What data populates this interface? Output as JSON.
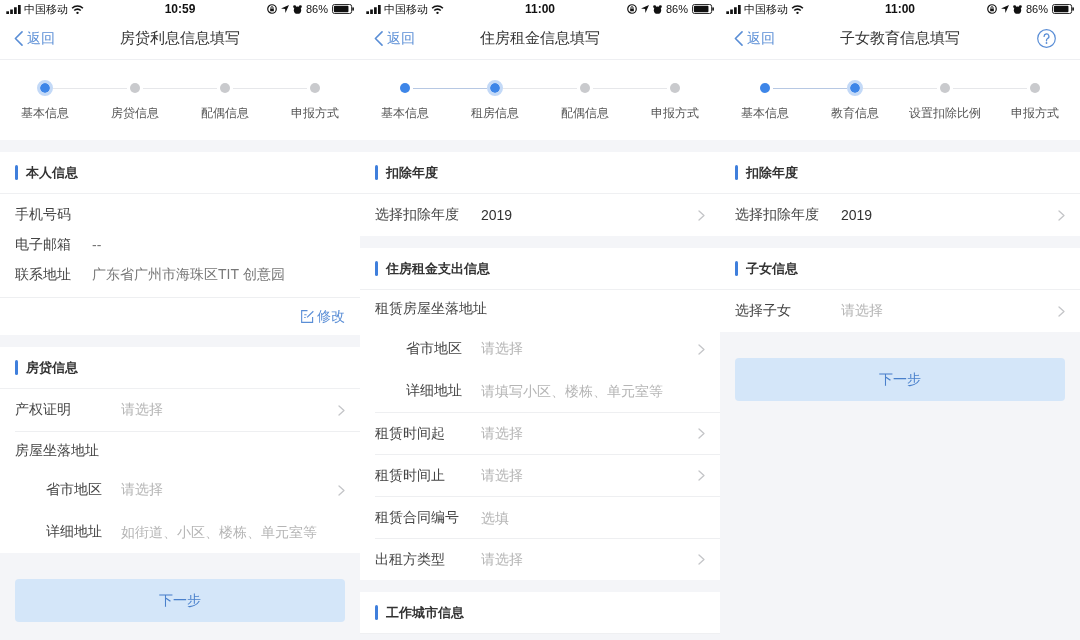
{
  "screens": [
    {
      "status_bar": {
        "carrier": "中国移动",
        "time": "10:59",
        "battery": "86%"
      },
      "nav": {
        "back": "返回",
        "title": "房贷利息信息填写"
      },
      "steps": [
        {
          "label": "基本信息",
          "done": false,
          "active": true
        },
        {
          "label": "房贷信息",
          "done": false,
          "active": false
        },
        {
          "label": "配偶信息",
          "done": false,
          "active": false
        },
        {
          "label": "申报方式",
          "done": false,
          "active": false
        }
      ],
      "sections": [
        {
          "title": "本人信息",
          "rows": [
            {
              "kind": "info",
              "label": "手机号码"
            },
            {
              "kind": "info",
              "label": "电子邮箱",
              "value": "--"
            },
            {
              "kind": "info",
              "label": "联系地址",
              "value": "广东省广州市海珠区TIT 创意园"
            }
          ],
          "action": "修改"
        },
        {
          "title": "房贷信息",
          "rows": [
            {
              "kind": "select",
              "label": "产权证明",
              "placeholder": "请选择"
            },
            {
              "kind": "group",
              "label": "房屋坐落地址",
              "children": [
                {
                  "kind": "select",
                  "label": "省市地区",
                  "placeholder": "请选择"
                },
                {
                  "kind": "input",
                  "label": "详细地址",
                  "placeholder": "如街道、小区、楼栋、单元室等"
                }
              ]
            }
          ]
        }
      ],
      "next_button": {
        "label": "下一步",
        "disabled": true
      }
    },
    {
      "status_bar": {
        "carrier": "中国移动",
        "time": "11:00",
        "battery": "86%"
      },
      "nav": {
        "back": "返回",
        "title": "住房租金信息填写"
      },
      "steps": [
        {
          "label": "基本信息",
          "done": true,
          "active": false
        },
        {
          "label": "租房信息",
          "done": false,
          "active": true
        },
        {
          "label": "配偶信息",
          "done": false,
          "active": false
        },
        {
          "label": "申报方式",
          "done": false,
          "active": false
        }
      ],
      "sections": [
        {
          "title": "扣除年度",
          "rows": [
            {
              "kind": "select",
              "label": "选择扣除年度",
              "value": "2019"
            }
          ]
        },
        {
          "title": "住房租金支出信息",
          "rows": [
            {
              "kind": "group",
              "label": "租赁房屋坐落地址",
              "children": [
                {
                  "kind": "select",
                  "label": "省市地区",
                  "placeholder": "请选择"
                },
                {
                  "kind": "input",
                  "label": "详细地址",
                  "placeholder": "请填写小区、楼栋、单元室等"
                }
              ]
            },
            {
              "kind": "select",
              "label": "租赁时间起",
              "placeholder": "请选择"
            },
            {
              "kind": "select",
              "label": "租赁时间止",
              "placeholder": "请选择"
            },
            {
              "kind": "input",
              "label": "租赁合同编号",
              "placeholder": "选填"
            },
            {
              "kind": "select",
              "label": "出租方类型",
              "placeholder": "请选择"
            }
          ]
        },
        {
          "title": "工作城市信息"
        }
      ]
    },
    {
      "status_bar": {
        "carrier": "中国移动",
        "time": "11:00",
        "battery": "86%"
      },
      "nav": {
        "back": "返回",
        "title": "子女教育信息填写",
        "help": true
      },
      "steps": [
        {
          "label": "基本信息",
          "done": true,
          "active": false
        },
        {
          "label": "教育信息",
          "done": false,
          "active": true
        },
        {
          "label": "设置扣除比例",
          "done": false,
          "active": false
        },
        {
          "label": "申报方式",
          "done": false,
          "active": false
        }
      ],
      "sections": [
        {
          "title": "扣除年度",
          "rows": [
            {
              "kind": "select",
              "label": "选择扣除年度",
              "value": "2019"
            }
          ]
        },
        {
          "title": "子女信息",
          "rows": [
            {
              "kind": "select",
              "label": "选择子女",
              "placeholder": "请选择"
            }
          ]
        }
      ],
      "next_button": {
        "label": "下一步",
        "disabled": true
      }
    }
  ]
}
